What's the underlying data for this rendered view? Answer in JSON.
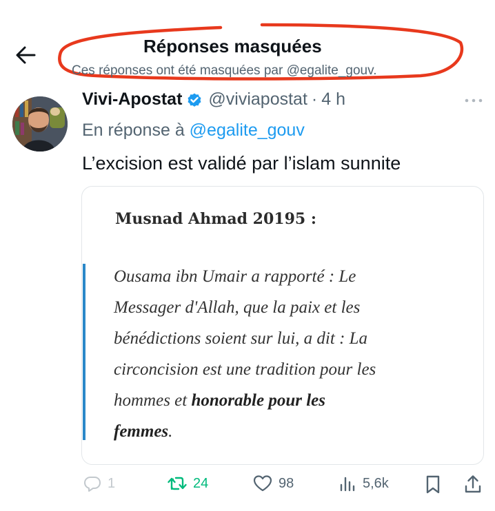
{
  "header": {
    "back_icon": "arrow-left-icon",
    "title": "Réponses masquées",
    "subtitle": "Ces réponses ont été masquées par @egalite_gouv."
  },
  "tweet": {
    "display_name": "Vivi-Apostat",
    "verified_icon": "verified-badge-icon",
    "handle": "@viviapostat",
    "separator": "·",
    "time": "4 h",
    "reply_prefix": "En réponse à",
    "reply_handle": "@egalite_gouv",
    "text": "L’excision est validé par l’islam sunnite"
  },
  "card": {
    "title": "Musnad Ahmad 20195 :",
    "lines": [
      "Ousama ibn Umair a rapporté : Le",
      "Messager d'Allah, que la paix et les",
      "bénédictions soient sur lui, a dit : La",
      "circoncision est une tradition pour les"
    ],
    "line5_normal": "hommes et ",
    "line5_bold": "honorable pour les",
    "line6_bold": "femmes",
    "line6_end": "."
  },
  "actions": {
    "replies": "1",
    "retweets": "24",
    "likes": "98",
    "views": "5,6k"
  },
  "colors": {
    "accent": "#1d9bf0",
    "retweet": "#00ba7c",
    "highlight": "#e8391d",
    "quote_bar": "#2b88c9"
  }
}
